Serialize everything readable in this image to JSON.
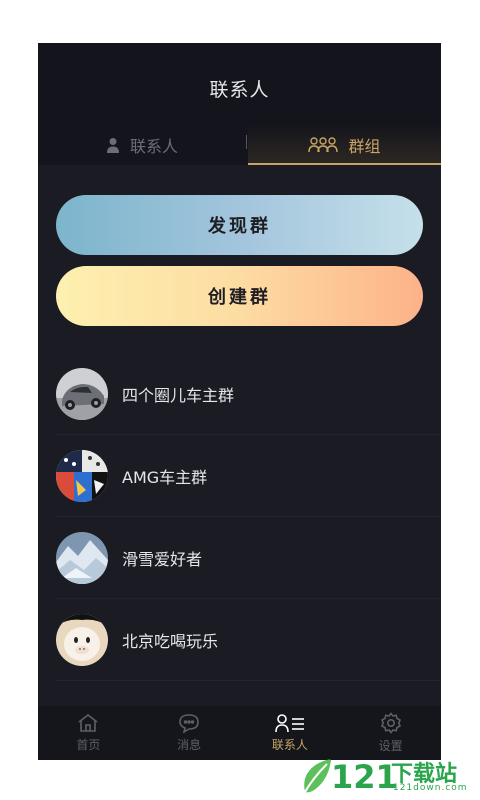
{
  "header": {
    "title": "联系人"
  },
  "tabs": [
    {
      "label": "联系人",
      "icon": "person-icon",
      "active": false
    },
    {
      "label": "群组",
      "icon": "group-icon",
      "active": true
    }
  ],
  "actions": {
    "discover_label": "发现群",
    "create_label": "创建群"
  },
  "groups": [
    {
      "name": "四个圈儿车主群",
      "avatar": "car-avatar"
    },
    {
      "name": "AMG车主群",
      "avatar": "pattern-avatar"
    },
    {
      "name": "滑雪爱好者",
      "avatar": "snow-mountain-avatar"
    },
    {
      "name": "北京吃喝玩乐",
      "avatar": "cartoon-avatar"
    }
  ],
  "bottom_nav": [
    {
      "label": "首页",
      "icon": "home-icon",
      "active": false
    },
    {
      "label": "消息",
      "icon": "message-icon",
      "active": false
    },
    {
      "label": "联系人",
      "icon": "contacts-icon",
      "active": true
    },
    {
      "label": "设置",
      "icon": "settings-icon",
      "active": false
    }
  ],
  "watermark": {
    "number": "121",
    "text": "下载站",
    "url": "121down.com"
  },
  "colors": {
    "accent": "#c8a463",
    "background": "#1b1c23",
    "header": "#14151c"
  }
}
